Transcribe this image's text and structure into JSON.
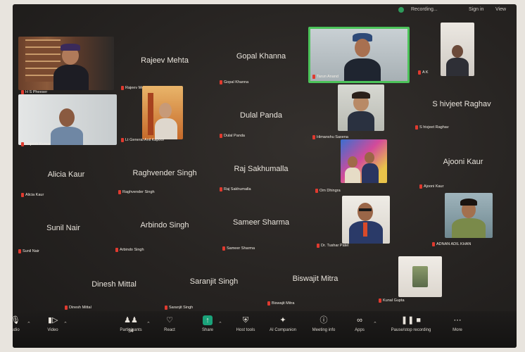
{
  "topbar": {
    "recording_label": "Recording...",
    "sign_in": "Sign in",
    "view": "View"
  },
  "tiles": {
    "hs_pheeser": {
      "label": "H S Pheeser"
    },
    "rajeev": {
      "name": "Rajeev Mehta",
      "label": "Rajeev Mehta"
    },
    "gopal": {
      "name": "Gopal Khanna",
      "label": "Gopal Khanna"
    },
    "tarun": {
      "label": "Tarun Anand"
    },
    "ak": {
      "label": "A K"
    },
    "rajnish": {
      "label": "Rajnish Kumar"
    },
    "anil": {
      "label": "Lt General Anil Kapoor"
    },
    "dulal": {
      "name": "Dulal Panda",
      "label": "Dulal Panda"
    },
    "himanshu": {
      "label": "Himanshu Saxena"
    },
    "shivjeet": {
      "name": "S hivjeet Raghav",
      "label": "S hivjeet Raghav"
    },
    "alicia": {
      "name": "Alicia Kaur",
      "label": "Alicia Kaur"
    },
    "raghvender": {
      "name": "Raghvender Singh",
      "label": "Raghvender Singh"
    },
    "raj": {
      "name": "Raj Sakhumalla",
      "label": "Raj Sakhumalla"
    },
    "om": {
      "label": "Om Dhingra"
    },
    "ajooni": {
      "name": "Ajooni Kaur",
      "label": "Ajooni Kaur"
    },
    "sunil": {
      "name": "Sunil Nair",
      "label": "Sunil Nair"
    },
    "arbindo": {
      "name": "Arbindo Singh",
      "label": "Arbindo Singh"
    },
    "sameer": {
      "name": "Sameer Sharma",
      "label": "Sameer Sharma"
    },
    "tushar": {
      "label": "Dr. Tushar Patel"
    },
    "adnan": {
      "label": "ADNAN ADIL KHAN"
    },
    "dinesh": {
      "name": "Dinesh Mittal",
      "label": "Dinesh Mittal"
    },
    "saranjit": {
      "name": "Saranjit Singh",
      "label": "Saranjit Singh"
    },
    "biswajit": {
      "name": "Biswajit Mitra",
      "label": "Biswajit Mitra"
    },
    "kunal": {
      "label": "Kunal Gupta"
    }
  },
  "toolbar": {
    "audio": "udio",
    "video": "Video",
    "participants": "Participants",
    "participants_count": "34",
    "react": "React",
    "share": "Share",
    "host_tools": "Host tools",
    "ai_companion": "AI Companion",
    "meeting_info": "Meeting info",
    "apps": "Apps",
    "pause_stop": "Pause/stop recording",
    "more": "More"
  },
  "colors": {
    "muted_mic": "#e03a2f",
    "active_speaker_border": "#4cc35a",
    "share_green": "#1aa37a",
    "recording_dot": "#2e9a5a"
  }
}
